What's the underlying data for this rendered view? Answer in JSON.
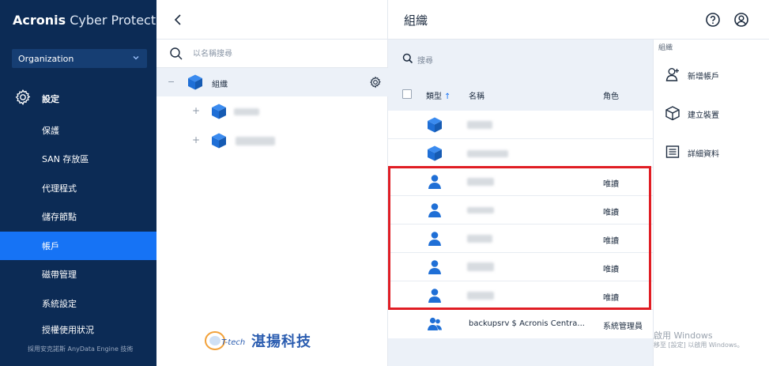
{
  "brand": {
    "name_bold": "Acronis",
    "name_rest": " Cyber Protect"
  },
  "org_select": {
    "value": "Organization"
  },
  "nav": {
    "settings_label": "設定",
    "items": [
      {
        "label": "保護",
        "active": false
      },
      {
        "label": "SAN 存放區",
        "active": false
      },
      {
        "label": "代理程式",
        "active": false
      },
      {
        "label": "儲存節點",
        "active": false
      },
      {
        "label": "帳戶",
        "active": true
      },
      {
        "label": "磁帶管理",
        "active": false
      },
      {
        "label": "系統設定",
        "active": false
      },
      {
        "label": "授權使用狀況",
        "active": false
      }
    ],
    "footer": "採用安克諾斯 AnyData Engine 技術"
  },
  "tree": {
    "search_placeholder": "以名稱搜尋",
    "root_label": "組織",
    "children": [
      {
        "toggle": "+"
      },
      {
        "toggle": "+"
      }
    ],
    "root_toggle": "−"
  },
  "watermark": {
    "text": "湛揚科技",
    "logo_text": "T-tech"
  },
  "main": {
    "title": "組織",
    "search_placeholder": "搜尋",
    "columns": {
      "type": "類型",
      "sort_arrow": "↑",
      "name": "名稱",
      "role": "角色"
    },
    "rows": [
      {
        "type": "unit-icon",
        "name": "",
        "role": ""
      },
      {
        "type": "unit-icon",
        "name": "",
        "role": ""
      },
      {
        "type": "user-icon",
        "name": "",
        "role": "唯讀"
      },
      {
        "type": "user-icon",
        "name": "",
        "role": "唯讀"
      },
      {
        "type": "user-icon",
        "name": "",
        "role": "唯讀"
      },
      {
        "type": "user-icon",
        "name": "",
        "role": "唯讀"
      },
      {
        "type": "user-icon",
        "name": "",
        "role": "唯讀"
      },
      {
        "type": "users-icon",
        "name": "backupsrv $ Acronis Centra...",
        "role": "系統管理員"
      }
    ]
  },
  "context": {
    "title": "組織",
    "items": [
      {
        "label": "新增帳戶",
        "icon": "add-user-icon"
      },
      {
        "label": "建立裝置",
        "icon": "cube-icon"
      },
      {
        "label": "詳細資料",
        "icon": "details-icon"
      }
    ],
    "windows_line1": "啟用 Windows",
    "windows_line2": "移至 [設定] 以啟用 Windows。"
  },
  "colors": {
    "sidebar_bg": "#0c2b55",
    "active_nav": "#1673f5",
    "icon_blue": "#1f6fd6",
    "highlight_red": "#e01d24",
    "list_bg": "#ecf1f8"
  }
}
